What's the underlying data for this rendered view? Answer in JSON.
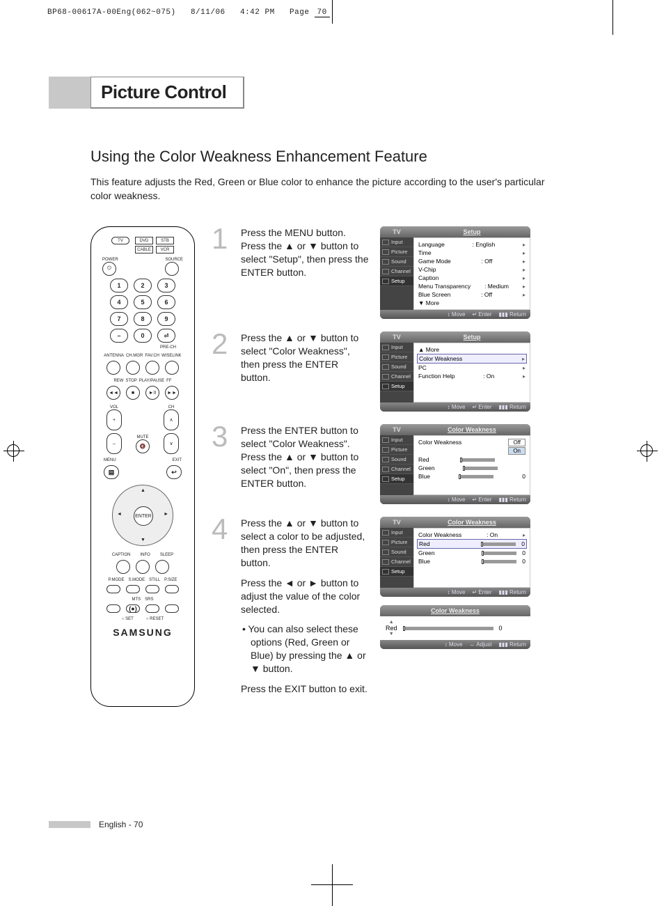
{
  "slug": {
    "file": "BP68-00617A-00Eng(062~075)",
    "date": "8/11/06",
    "time": "4:42 PM",
    "page_label": "Page",
    "page_num": "70"
  },
  "chapter": "Picture Control",
  "section": "Using the Color Weakness Enhancement Feature",
  "intro": "This feature adjusts the Red, Green or Blue color to enhance the picture according to the user's particular color weakness.",
  "remote": {
    "tv": "TV",
    "dvd": "DVD",
    "stb": "STB",
    "cable": "CABLE",
    "vcr": "VCR",
    "power": "POWER",
    "source": "SOURCE",
    "nums": [
      "1",
      "2",
      "3",
      "4",
      "5",
      "6",
      "7",
      "8",
      "9",
      "0"
    ],
    "dash": "–",
    "prech": "PRE-CH",
    "antenna": "ANTENNA",
    "chmgr": "CH.MGR",
    "favch": "FAV.CH",
    "wiselink": "WISELINK",
    "rew": "REW",
    "stop": "STOP",
    "play": "PLAY/PAUSE",
    "ff": "FF",
    "vol": "VOL",
    "ch": "CH",
    "mute": "MUTE",
    "menu": "MENU",
    "exit": "EXIT",
    "enter": "ENTER",
    "caption": "CAPTION",
    "info": "INFO",
    "sleep": "SLEEP",
    "pmode": "P.MODE",
    "smode": "S.MODE",
    "still": "STILL",
    "psize": "P.SIZE",
    "mts": "MTS",
    "srs": "SRS",
    "set": "SET",
    "reset": "RESET",
    "brand": "SAMSUNG"
  },
  "steps": [
    {
      "n": "1",
      "text": "Press the MENU button.\nPress the ▲ or ▼ button to select \"Setup\", then press the ENTER button."
    },
    {
      "n": "2",
      "text": "Press the ▲ or ▼ button to select \"Color Weakness\", then press the ENTER button."
    },
    {
      "n": "3",
      "text": "Press the ENTER button to select \"Color Weakness\". Press the ▲ or ▼ button to select \"On\", then press the ENTER button."
    },
    {
      "n": "4",
      "text": "Press the ▲ or ▼ button to select a color to be adjusted, then press the ENTER button.",
      "text2": "Press the ◄ or ► button to adjust the value of the color selected.",
      "bullet": "You can also select these options (Red, Green or Blue) by pressing the ▲ or ▼ button.",
      "text3": "Press the EXIT button to exit."
    }
  ],
  "osd_side": [
    "Input",
    "Picture",
    "Sound",
    "Channel",
    "Setup"
  ],
  "osd1": {
    "title": "Setup",
    "tv": "TV",
    "items": [
      {
        "l": "Language",
        "v": ": English",
        "a": "▸"
      },
      {
        "l": "Time",
        "v": "",
        "a": "▸"
      },
      {
        "l": "Game Mode",
        "v": ": Off",
        "a": "▸"
      },
      {
        "l": "V-Chip",
        "v": "",
        "a": "▸"
      },
      {
        "l": "Caption",
        "v": "",
        "a": "▸"
      },
      {
        "l": "Menu Transparency",
        "v": ": Medium",
        "a": "▸"
      },
      {
        "l": "Blue Screen",
        "v": ": Off",
        "a": "▸"
      },
      {
        "l": "▼ More",
        "v": "",
        "a": ""
      }
    ]
  },
  "osd2": {
    "title": "Setup",
    "tv": "TV",
    "items": [
      {
        "l": "▲ More",
        "v": "",
        "a": ""
      },
      {
        "l": "Color Weakness",
        "v": "",
        "a": "▸",
        "sel": true
      },
      {
        "l": "PC",
        "v": "",
        "a": "▸"
      },
      {
        "l": "Function Help",
        "v": ": On",
        "a": "▸"
      }
    ]
  },
  "osd3": {
    "title": "Color Weakness",
    "tv": "TV",
    "cw_label": "Color Weakness",
    "off": "Off",
    "on": "On",
    "rows": [
      {
        "l": "Red",
        "v": ""
      },
      {
        "l": "Green",
        "v": ""
      },
      {
        "l": "Blue",
        "v": "0"
      }
    ]
  },
  "osd4": {
    "title": "Color Weakness",
    "tv": "TV",
    "items": [
      {
        "l": "Color Weakness",
        "v": ": On",
        "a": "▸"
      },
      {
        "l": "Red",
        "v": "0",
        "sel": true,
        "slider": true
      },
      {
        "l": "Green",
        "v": "0",
        "slider": true
      },
      {
        "l": "Blue",
        "v": "0",
        "slider": true
      }
    ]
  },
  "osd5": {
    "title": "Color Weakness",
    "label": "Red",
    "value": "0"
  },
  "osd_foot": {
    "move": "Move",
    "enter": "Enter",
    "return": "Return",
    "adjust": "Adjust",
    "move_glyph": "↕",
    "enter_glyph": "↵",
    "return_glyph": "▮▮▮",
    "adjust_glyph": "↔"
  },
  "footer": {
    "lang": "English",
    "page": "70"
  }
}
